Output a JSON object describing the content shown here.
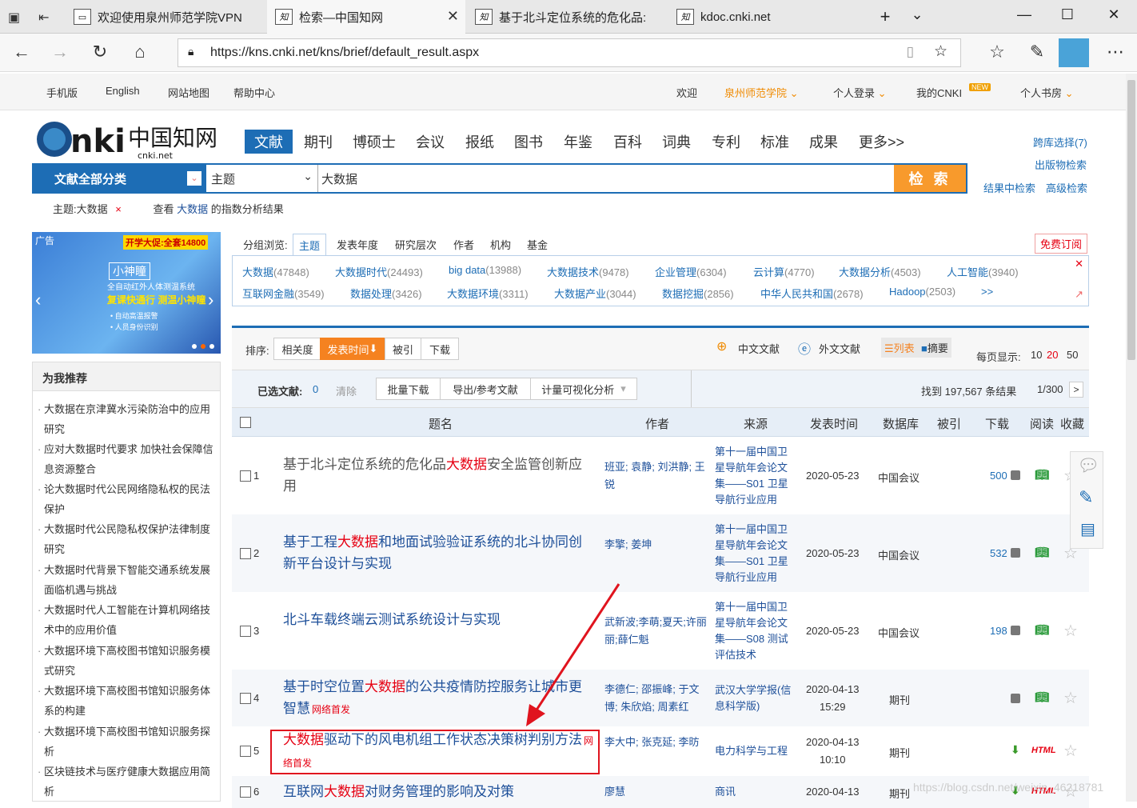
{
  "browser": {
    "tabs": [
      {
        "label": "欢迎使用泉州师范学院VPN"
      },
      {
        "label": "检索—中国知网"
      },
      {
        "label": "基于北斗定位系统的危化品:"
      },
      {
        "label": "kdoc.cnki.net"
      }
    ],
    "url": "https://kns.cnki.net/kns/brief/default_result.aspx",
    "new_tab": "+",
    "tab_list": "⌄"
  },
  "sitetop": {
    "links": [
      "手机版",
      "English",
      "网站地图",
      "帮助中心"
    ],
    "welcome": "欢迎",
    "institution": "泉州师范学院",
    "login": "个人登录",
    "my_cnki": "我的CNKI",
    "new_badge": "NEW",
    "bookroom": "个人书房"
  },
  "logo": {
    "text": "cnki 中国知网",
    "sub": "cnki.net"
  },
  "nav": [
    "文献",
    "期刊",
    "博硕士",
    "会议",
    "报纸",
    "图书",
    "年鉴",
    "百科",
    "词典",
    "专利",
    "标准",
    "成果",
    "更多>>"
  ],
  "search": {
    "category": "文献全部分类",
    "field": "主题",
    "keyword": "大数据",
    "button": "检 索"
  },
  "right_links": [
    "跨库选择(7)",
    "出版物检索",
    "结果中检索",
    "高级检索"
  ],
  "crumb": {
    "filter": "主题:大数据",
    "close": "×",
    "index_prefix": "查看",
    "index_kw": "大数据",
    "index_suffix": "的指数分析结果"
  },
  "ad": {
    "label": "广告",
    "promo": "开学大促:全套14800",
    "product": "小神瞳",
    "line1": "全自动红外人体测温系统",
    "line2": "复课快通行 测温小神瞳",
    "bullet1": "• 自动高温报警",
    "bullet2": "• 人员身份识别"
  },
  "recommend": {
    "title": "为我推荐",
    "items": [
      "大数据在京津冀水污染防治中的应用研究",
      "应对大数据时代要求 加快社会保障信息资源整合",
      "论大数据时代公民网络隐私权的民法保护",
      "大数据时代公民隐私权保护法律制度研究",
      "大数据时代背景下智能交通系统发展面临机遇与挑战",
      "大数据时代人工智能在计算机网络技术中的应用价值",
      "大数据环境下高校图书馆知识服务模式研究",
      "大数据环境下高校图书馆知识服务体系的构建",
      "大数据环境下高校图书馆知识服务探析",
      "区块链技术与医疗健康大数据应用简析"
    ]
  },
  "facets": {
    "label": "分组浏览:",
    "tabs": [
      "主题",
      "发表年度",
      "研究层次",
      "作者",
      "机构",
      "基金"
    ],
    "subscribe": "免费订阅",
    "row1": [
      [
        "大数据",
        "(47848)"
      ],
      [
        "大数据时代",
        "(24493)"
      ],
      [
        "big data",
        "(13988)"
      ],
      [
        "大数据技术",
        "(9478)"
      ],
      [
        "企业管理",
        "(6304)"
      ],
      [
        "云计算",
        "(4770)"
      ],
      [
        "大数据分析",
        "(4503)"
      ],
      [
        "人工智能",
        "(3940)"
      ]
    ],
    "row2": [
      [
        "互联网金融",
        "(3549)"
      ],
      [
        "数据处理",
        "(3426)"
      ],
      [
        "大数据环境",
        "(3311)"
      ],
      [
        "大数据产业",
        "(3044)"
      ],
      [
        "数据挖掘",
        "(2856)"
      ],
      [
        "中华人民共和国",
        "(2678)"
      ],
      [
        "Hadoop",
        "(2503)"
      ]
    ],
    "more": ">>"
  },
  "sort": {
    "label": "排序:",
    "options": [
      "相关度",
      "发表时间",
      "被引",
      "下载"
    ],
    "zh": "中文文献",
    "en": "外文文献",
    "list_view": "列表",
    "abstract_view": "摘要",
    "per_page_label": "每页显示:",
    "per_page": [
      "10",
      "20",
      "50"
    ]
  },
  "selection": {
    "label": "已选文献:",
    "count": "0",
    "clear": "清除",
    "batch": "批量下载",
    "export": "导出/参考文献",
    "viz": "计量可视化分析",
    "found": "找到 197,567 条结果",
    "page": "1/300",
    "next": ">"
  },
  "columns": [
    "题名",
    "作者",
    "来源",
    "发表时间",
    "数据库",
    "被引",
    "下载",
    "阅读",
    "收藏"
  ],
  "rows": [
    {
      "n": "1",
      "title_pre": "基于北斗定位系统的危化品",
      "title_hl": "大数据",
      "title_post": "安全监管创新应用",
      "tag": "",
      "authors": "班亚; 袁静; 刘洪静; 王锐",
      "source": "第十一届中国卫星导航年会论文集——S01 卫星导航行业应用",
      "date": "2020-05-23",
      "time": "",
      "db": "中国会议",
      "downloads": "500"
    },
    {
      "n": "2",
      "title_pre": "基于工程",
      "title_hl": "大数据",
      "title_post": "和地面试验验证系统的北斗协同创新平台设计与实现",
      "tag": "",
      "authors": "李擎; 姜坤",
      "source": "第十一届中国卫星导航年会论文集——S01 卫星导航行业应用",
      "date": "2020-05-23",
      "time": "",
      "db": "中国会议",
      "downloads": "532"
    },
    {
      "n": "3",
      "title_pre": "北斗车载终端云测试系统设计与实现",
      "title_hl": "",
      "title_post": "",
      "tag": "",
      "authors": "武新波;李萌;夏天;许丽丽;薛仁魁",
      "source": "第十一届中国卫星导航年会论文集——S08 测试评估技术",
      "date": "2020-05-23",
      "time": "",
      "db": "中国会议",
      "downloads": "198"
    },
    {
      "n": "4",
      "title_pre": "基于时空位置",
      "title_hl": "大数据",
      "title_post": "的公共疫情防控服务让城市更智慧",
      "tag": "网络首发",
      "authors": "李德仁; 邵振峰; 于文博; 朱欣焰; 周素红",
      "source": "武汉大学学报(信息科学版)",
      "date": "2020-04-13",
      "time": "15:29",
      "db": "期刊",
      "downloads": ""
    },
    {
      "n": "5",
      "title_pre": "",
      "title_hl": "大数据",
      "title_post": "驱动下的风电机组工作状态决策树判别方法",
      "tag": "网络首发",
      "authors": "李大中; 张克延; 李昉",
      "source": "电力科学与工程",
      "date": "2020-04-13",
      "time": "10:10",
      "db": "期刊",
      "downloads": ""
    },
    {
      "n": "6",
      "title_pre": "互联网",
      "title_hl": "大数据",
      "title_post": "对财务管理的影响及对策",
      "tag": "",
      "authors": "廖慧",
      "source": "商讯",
      "date": "2020-04-13",
      "time": "",
      "db": "期刊",
      "downloads": ""
    }
  ],
  "html_label": "HTML",
  "watermark": "https://blog.csdn.net/weixin_46218781",
  "colors": {
    "primary": "#1d6db5",
    "accent": "#f89a2c",
    "highlight": "#e60012",
    "annotation": "#e0141e"
  }
}
